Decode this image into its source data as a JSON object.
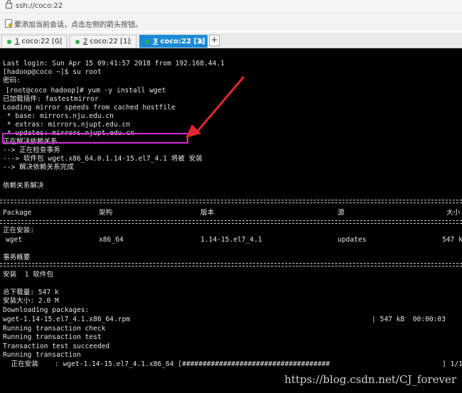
{
  "address_bar": {
    "url": "ssh://coco:22"
  },
  "hint_bar": {
    "text": "要添加当前会话，点击左侧的箭头按钮。"
  },
  "tabs": [
    {
      "num": "1",
      "label": " coco:22 [0]"
    },
    {
      "num": "2",
      "label": " coco:22 [1]"
    },
    {
      "num": "3",
      "label": " coco:22 [2]"
    }
  ],
  "plus_label": "+",
  "terminal": {
    "lines": [
      "Last login: Sun Apr 15 09:41:57 2018 from 192.168.44.1",
      "[hadoop@coco ~]$ su root",
      "密码:",
      "[root@coco hadoop]# yum -y install wget",
      "已加载插件: fastestmirror",
      "Loading mirror speeds from cached hostfile",
      " * base: mirrors.nju.edu.cn",
      " * extras: mirrors.njupt.edu.cn",
      " * updates: mirrors.njupt.edu.cn",
      "正在解决依赖关系",
      "--> 正在检查事务",
      "---> 软件包 wget.x86_64.0.1.14-15.el7_4.1 将被 安装",
      "--> 解决依赖关系完成",
      "依赖关系解决",
      "正在安装:",
      "事务概要",
      "安装  1 软件包",
      "总下载量: 547 k",
      "安装大小: 2.0 M",
      "Downloading packages:",
      "wget-1.14-15.el7_4.1.x86_64.rpm",
      "Running transaction check",
      "Running transaction test",
      "Transaction test succeeded",
      "Running transaction",
      "  正在安装    : wget-1.14-15.el7_4.1.x86_64 [####################################"
    ],
    "table_header": {
      "package": "Package",
      "arch": "架构",
      "version": "版本",
      "repo": "源",
      "size": "大小"
    },
    "table_row": {
      "package": "wget",
      "arch": "x86_64",
      "version": "1.14-15.el7_4.1",
      "repo": "updates",
      "size": "547 k"
    },
    "download_stat": "| 547 kB  00:00:03",
    "progress_tail": "] 1/1"
  },
  "watermark": "https://blog.csdn.net/CJ_forever",
  "colors": {
    "terminal_bg": "#000000",
    "active_tab": "#1c8bd6",
    "highlight_box": "#d12bd9",
    "arrow": "#e0282d"
  }
}
